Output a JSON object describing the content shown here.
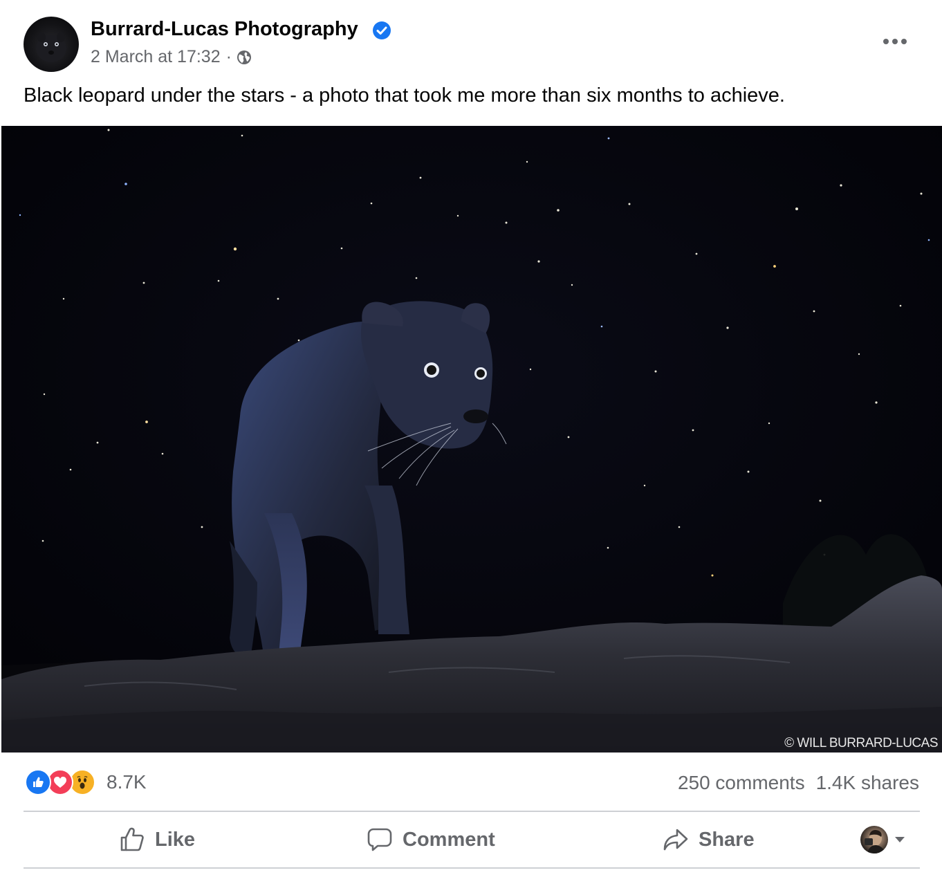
{
  "post": {
    "author": "Burrard-Lucas Photography",
    "verified": true,
    "timestamp": "2 March at 17:32",
    "separator": "·",
    "audience_icon": "globe-icon",
    "more_icon": "more-options-icon",
    "caption": "Black leopard under the stars - a photo that took me more than six months to achieve."
  },
  "photo": {
    "watermark": "© WILL BURRARD-LUCAS"
  },
  "stats": {
    "reaction_icons": [
      "like-icon",
      "love-icon",
      "wow-icon"
    ],
    "reaction_count": "8.7K",
    "comments": "250 comments",
    "shares": "1.4K shares"
  },
  "actions": {
    "like": "Like",
    "comment": "Comment",
    "share": "Share"
  },
  "colors": {
    "brand_blue": "#1877f2",
    "secondary_text": "#65676b",
    "love_red": "#f33e58",
    "wow_yellow": "#f7b125",
    "divider": "#ced0d4"
  }
}
